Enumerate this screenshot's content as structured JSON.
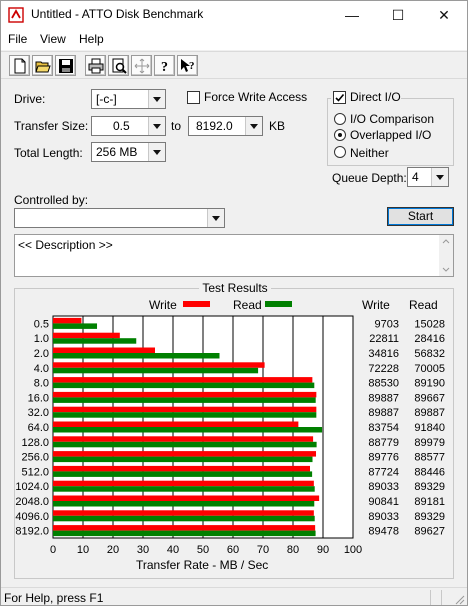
{
  "window": {
    "title": "Untitled - ATTO Disk Benchmark",
    "minimize": "—",
    "maximize": "☐",
    "close": "✕"
  },
  "menu": {
    "file": "File",
    "view": "View",
    "help": "Help"
  },
  "toolbar": {
    "icons": [
      "new-icon",
      "open-icon",
      "save-icon",
      "print-icon",
      "print-preview-icon",
      "move-icon",
      "about-icon",
      "context-help-icon"
    ]
  },
  "settings": {
    "drive_label": "Drive:",
    "drive_value": "[-c-]",
    "transfer_size_label": "Transfer Size:",
    "transfer_from": "0.5",
    "to_label": "to",
    "transfer_to": "8192.0",
    "kb_label": "KB",
    "total_length_label": "Total Length:",
    "total_length_value": "256 MB",
    "force_write_label": "Force Write Access",
    "force_write_checked": false,
    "direct_io_label": "Direct I/O",
    "direct_io_checked": true,
    "io_comparison_label": "I/O Comparison",
    "overlapped_io_label": "Overlapped I/O",
    "neither_label": "Neither",
    "selected_mode": "Overlapped I/O",
    "queue_depth_label": "Queue Depth:",
    "queue_depth_value": "4",
    "controlled_by_label": "Controlled by:",
    "controlled_by_value": "",
    "start_label": "Start",
    "description_text": "<< Description >>"
  },
  "results": {
    "title": "Test Results",
    "write_legend": "Write",
    "read_legend": "Read",
    "write_header": "Write",
    "read_header": "Read"
  },
  "chart_data": {
    "type": "bar",
    "orientation": "horizontal",
    "categories": [
      "0.5",
      "1.0",
      "2.0",
      "4.0",
      "8.0",
      "16.0",
      "32.0",
      "64.0",
      "128.0",
      "256.0",
      "512.0",
      "1024.0",
      "2048.0",
      "4096.0",
      "8192.0"
    ],
    "series": [
      {
        "name": "Write",
        "color": "#ff0000",
        "values": [
          9703,
          22811,
          34816,
          72228,
          88530,
          89887,
          89887,
          83754,
          88779,
          89776,
          87724,
          89033,
          90841,
          89033,
          89478
        ],
        "labels": [
          "9703",
          "22811",
          "34816",
          "72228",
          "88530",
          "89887",
          "89887",
          "83754",
          "88779",
          "89776",
          "87724",
          "89033",
          "90841",
          "89033",
          "89478"
        ]
      },
      {
        "name": "Read",
        "color": "#008000",
        "values": [
          15028,
          28416,
          56832,
          70005,
          89190,
          89667,
          89887,
          91840,
          89979,
          88577,
          88446,
          89329,
          89181,
          89329,
          89627
        ],
        "labels": [
          "15028",
          "28416",
          "56832",
          "70005",
          "89190",
          "89667",
          "89887",
          "91840",
          "89979",
          "88577",
          "88446",
          "89329",
          "89181",
          "89329",
          "89627"
        ]
      }
    ],
    "xticks": [
      "0",
      "10",
      "20",
      "30",
      "40",
      "50",
      "60",
      "70",
      "80",
      "90",
      "100"
    ],
    "xlim": [
      0,
      100
    ],
    "xlabel": "Transfer Rate - MB / Sec",
    "grid": true,
    "colors": {
      "write": "#ff0000",
      "read": "#008000"
    }
  },
  "status": {
    "text": "For Help, press F1"
  }
}
